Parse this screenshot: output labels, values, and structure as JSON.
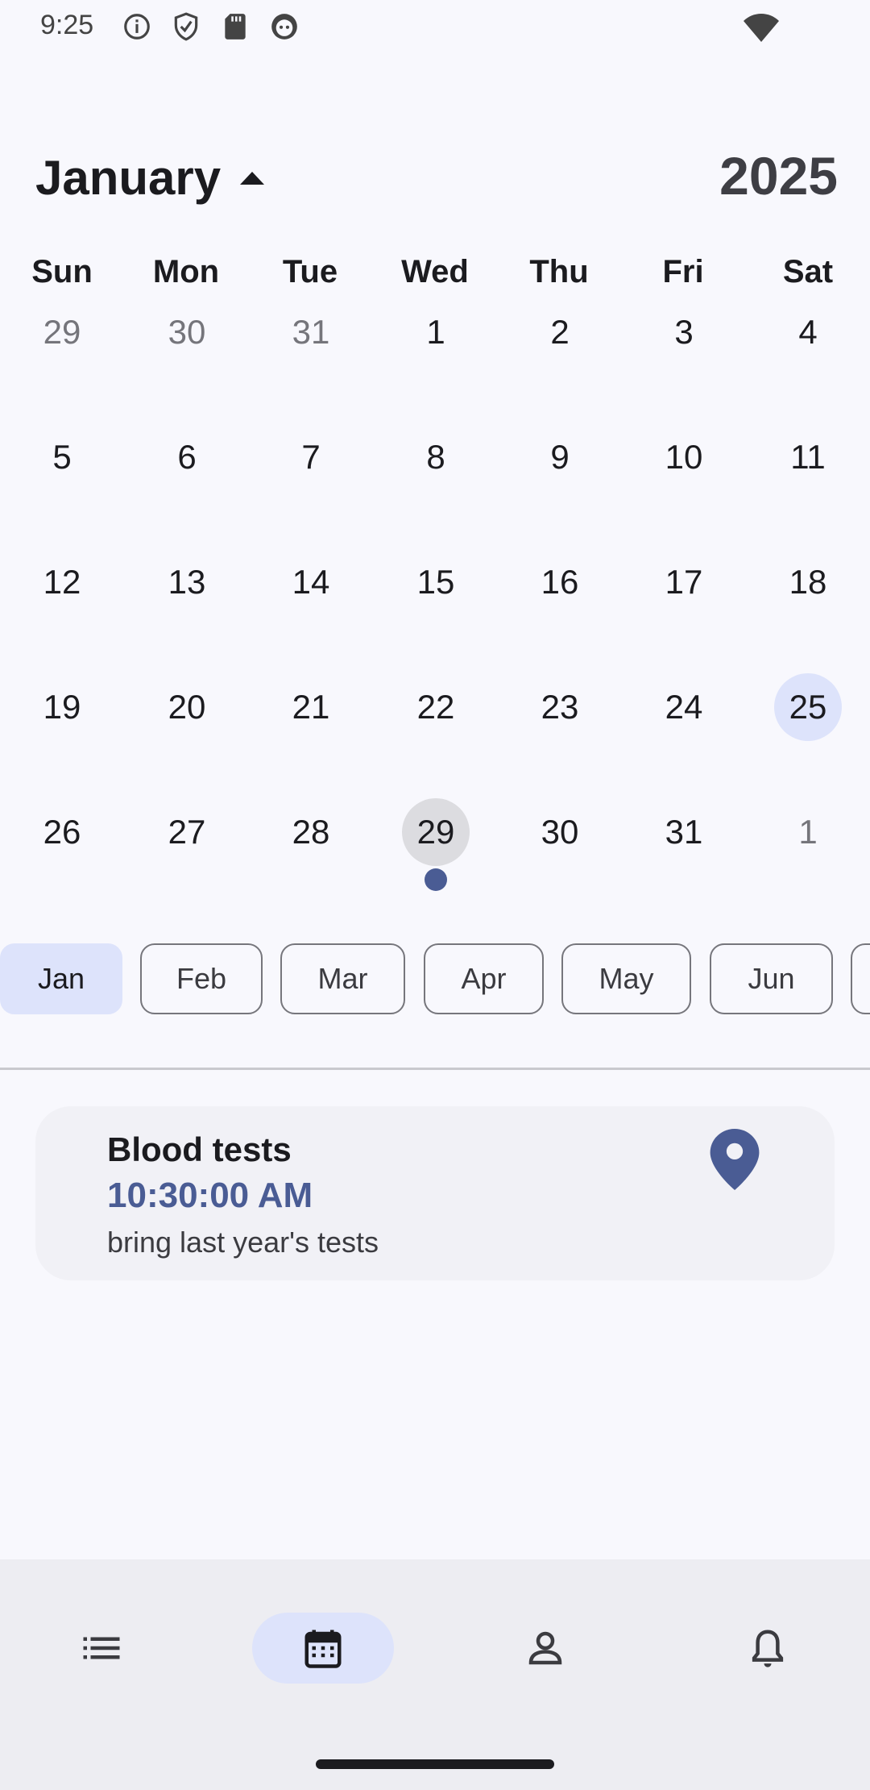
{
  "status_bar": {
    "time": "9:25",
    "icons": [
      "info-icon",
      "shield-icon",
      "sd-card-icon",
      "android-face-icon",
      "wifi-icon"
    ]
  },
  "header": {
    "month": "January",
    "year": "2025"
  },
  "weekdays": [
    "Sun",
    "Mon",
    "Tue",
    "Wed",
    "Thu",
    "Fri",
    "Sat"
  ],
  "weeks": [
    [
      "29",
      "30",
      "31",
      "1",
      "2",
      "3",
      "4"
    ],
    [
      "5",
      "6",
      "7",
      "8",
      "9",
      "10",
      "11"
    ],
    [
      "12",
      "13",
      "14",
      "15",
      "16",
      "17",
      "18"
    ],
    [
      "19",
      "20",
      "21",
      "22",
      "23",
      "24",
      "25"
    ],
    [
      "26",
      "27",
      "28",
      "29",
      "30",
      "31",
      "1"
    ]
  ],
  "months": [
    "Jan",
    "Feb",
    "Mar",
    "Apr",
    "May",
    "Jun"
  ],
  "event": {
    "title": "Blood tests",
    "time": "10:30:00 AM",
    "note": "bring last year's tests"
  },
  "nav": [
    "list-icon",
    "calendar-icon",
    "person-icon",
    "bell-icon"
  ],
  "colors": {
    "accent": "#4a5c94",
    "highlight": "#dde3fb",
    "selected": "#dcdce0"
  }
}
